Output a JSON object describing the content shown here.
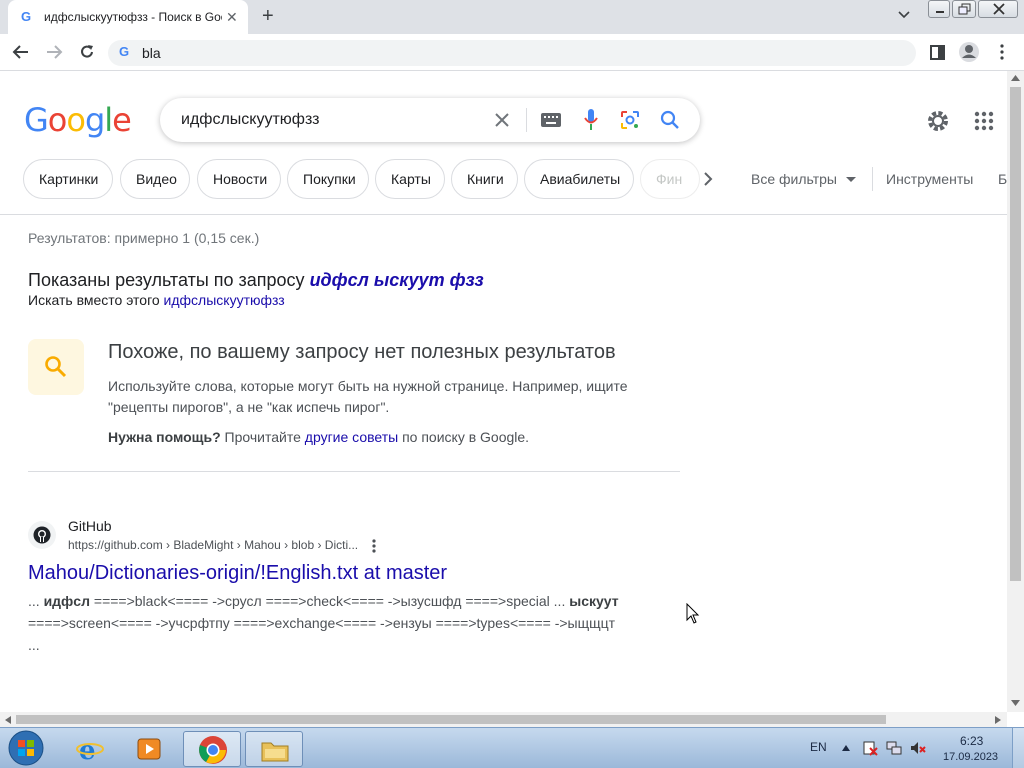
{
  "browser": {
    "tab_title": "идфслыскуутюфзз - Поиск в Google",
    "new_tab_label": "+",
    "address": "bla"
  },
  "google": {
    "logo": [
      "G",
      "o",
      "o",
      "g",
      "l",
      "e"
    ],
    "logo_colors": [
      "#4285f4",
      "#ea4335",
      "#fbbc05",
      "#4285f4",
      "#34a853",
      "#ea4335"
    ],
    "query": "идфслыскуутюфзз",
    "chips": [
      "Картинки",
      "Видео",
      "Новости",
      "Покупки",
      "Карты",
      "Книги",
      "Авиабилеты",
      "Фин"
    ],
    "all_filters": "Все фильтры",
    "tools": "Инструменты",
    "cut_label": "Б",
    "stats": "Результатов: примерно 1 (0,15 сек.)",
    "shown_prefix": "Показаны результаты по запросу ",
    "shown_query": "идфсл ыскуут фзз",
    "instead_prefix": "Искать вместо этого ",
    "instead_query": "идфслыскуутюфзз",
    "no_results_title": "Похоже, по вашему запросу нет полезных результатов",
    "no_results_text": "Используйте слова, которые могут быть на нужной странице. Например, ищите \"рецепты пирогов\", а не \"как испечь пирог\".",
    "help_bold": "Нужна помощь?",
    "help_mid": " Прочитайте ",
    "help_link": "другие советы",
    "help_end": " по поиску в Google."
  },
  "result": {
    "site": "GitHub",
    "url": "https://github.com › BladeMight › Mahou › blob › Dicti...",
    "title": "Mahou/Dictionaries-origin/!English.txt at master",
    "snippet_1": "... ",
    "snippet_b1": "идфсл",
    "snippet_2": " ====>black<==== ->срусл ====>check<==== ->ызусшфд ====>special ... ",
    "snippet_b2": "ыскуут",
    "snippet_3": " ====>screen<==== ->учсрфтпу ====>exchange<==== ->ензуы ====>types<==== ->ыщщцт ..."
  },
  "taskbar": {
    "language": "EN",
    "time": "6:23",
    "date": "17.09.2023"
  },
  "colors": {
    "accent_blue": "#4285f4",
    "link": "#1a0dab",
    "titlebar": "#dee1e6"
  }
}
